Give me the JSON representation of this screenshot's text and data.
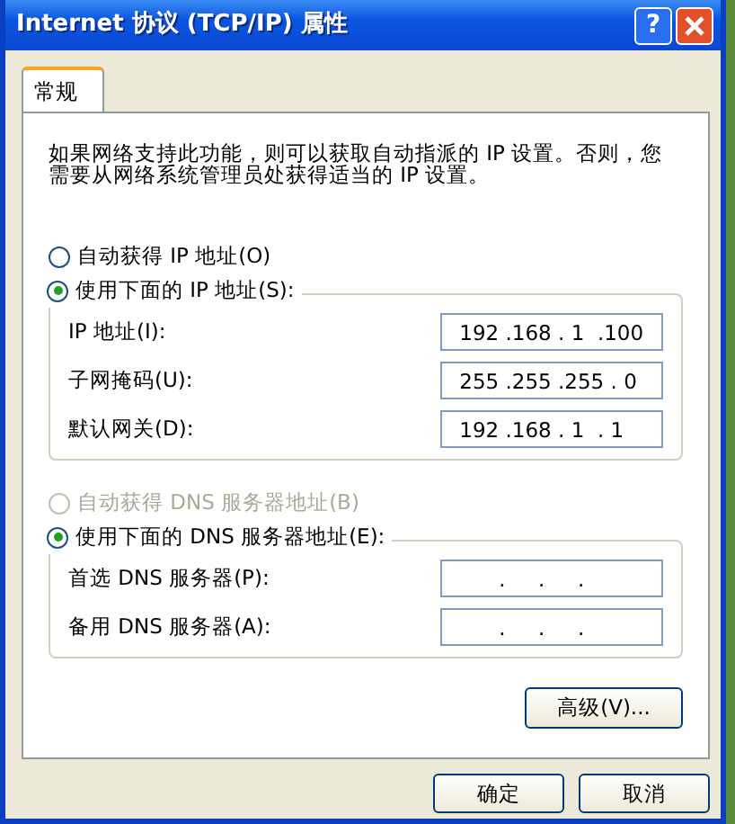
{
  "window": {
    "title": "Internet 协议 (TCP/IP) 属性",
    "help_button": "?"
  },
  "tabs": [
    {
      "label": "常规",
      "selected": true
    }
  ],
  "intro": "如果网络支持此功能，则可以获取自动指派的 IP 设置。否则，您需要从网络系统管理员处获得适当的 IP 设置。",
  "ip_section": {
    "options": [
      {
        "label": "自动获得 IP 地址(O)",
        "selected": false,
        "disabled": false
      },
      {
        "label": "使用下面的 IP 地址(S):",
        "selected": true,
        "disabled": false
      }
    ],
    "fields": [
      {
        "label": "IP 地址(I):",
        "value": " 192 .168 . 1  .100"
      },
      {
        "label": "子网掩码(U):",
        "value": " 255 .255 .255 . 0"
      },
      {
        "label": "默认网关(D):",
        "value": " 192 .168 . 1  . 1"
      }
    ]
  },
  "dns_section": {
    "options": [
      {
        "label": "自动获得 DNS 服务器地址(B)",
        "selected": false,
        "disabled": true
      },
      {
        "label": "使用下面的 DNS 服务器地址(E):",
        "selected": true,
        "disabled": false
      }
    ],
    "fields": [
      {
        "label": "首选 DNS 服务器(P):",
        "value": "       .     .     ."
      },
      {
        "label": "备用 DNS 服务器(A):",
        "value": "       .     .     ."
      }
    ]
  },
  "advanced_button": "高级(V)...",
  "buttons": [
    "确定",
    "取消"
  ]
}
